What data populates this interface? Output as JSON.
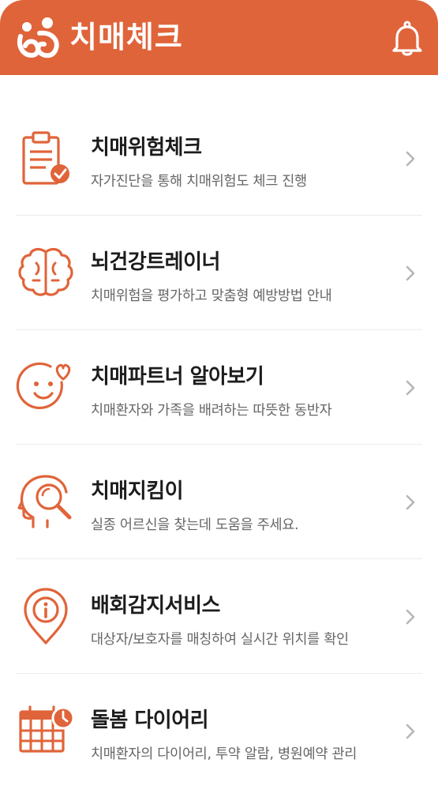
{
  "header": {
    "app_title": "치매체크",
    "logo_icon": "family-logo-icon",
    "bell_icon": "bell-icon",
    "background_color": "#e0643a"
  },
  "menu": {
    "accent_color": "#e0643a",
    "items": [
      {
        "title": "치매위험체크",
        "description": "자가진단을 통해 치매위험도 체크 진행",
        "icon": "clipboard-check-icon"
      },
      {
        "title": "뇌건강트레이너",
        "description": "치매위험을 평가하고 맞춤형 예방방법 안내",
        "icon": "brain-icon"
      },
      {
        "title": "치매파트너 알아보기",
        "description": "치매환자와 가족을 배려하는 따뜻한 동반자",
        "icon": "smile-heart-icon"
      },
      {
        "title": "치매지킴이",
        "description": "실종 어르신을 찾는데 도움을 주세요.",
        "icon": "head-search-icon"
      },
      {
        "title": "배회감지서비스",
        "description": "대상자/보호자를 매칭하여 실시간 위치를 확인",
        "icon": "location-pin-info-icon"
      },
      {
        "title": "돌봄 다이어리",
        "description": "치매환자의 다이어리, 투약 알람, 병원예약 관리",
        "icon": "calendar-clock-icon"
      }
    ]
  }
}
